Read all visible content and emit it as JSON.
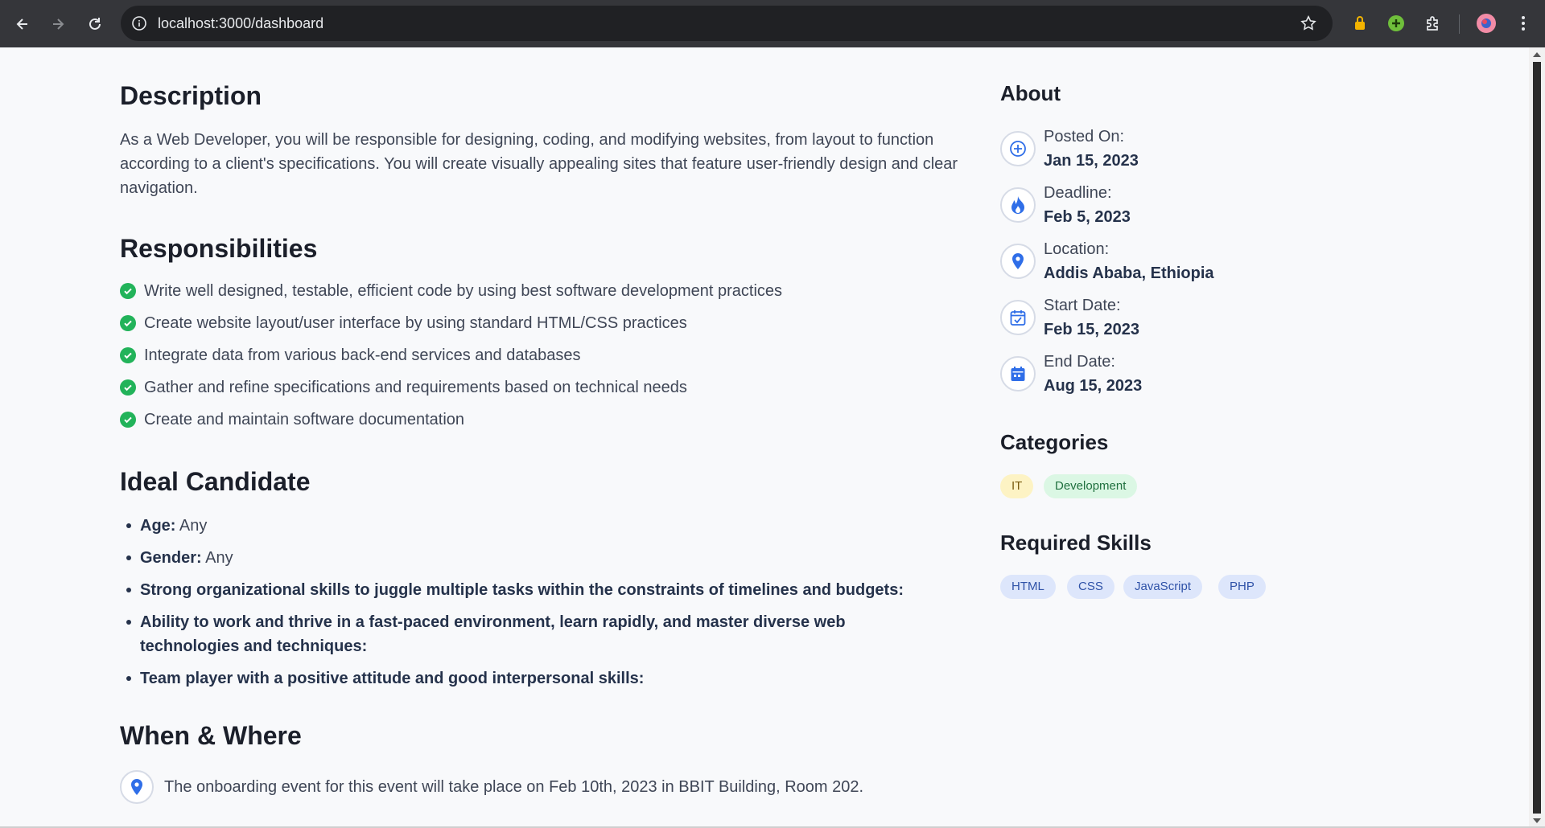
{
  "browser": {
    "url": "localhost:3000/dashboard"
  },
  "description": {
    "heading": "Description",
    "text": "As a Web Developer, you will be responsible for designing, coding, and modifying websites, from layout to function according to a client's specifications. You will create visually appealing sites that feature user-friendly design and clear navigation."
  },
  "responsibilities": {
    "heading": "Responsibilities",
    "items": [
      "Write well designed, testable, efficient code by using best software development practices",
      "Create website layout/user interface by using standard HTML/CSS practices",
      "Integrate data from various back-end services and databases",
      "Gather and refine specifications and requirements based on technical needs",
      "Create and maintain software documentation"
    ]
  },
  "ideal_candidate": {
    "heading": "Ideal Candidate",
    "age_label": "Age:",
    "age_value": "Any",
    "gender_label": "Gender:",
    "gender_value": "Any",
    "traits": [
      "Strong organizational skills to juggle multiple tasks within the constraints of timelines and budgets:",
      "Ability to work and thrive in a fast-paced environment, learn rapidly, and master diverse web technologies and techniques:",
      "Team player with a positive attitude and good interpersonal skills:"
    ]
  },
  "when_where": {
    "heading": "When & Where",
    "text": "The onboarding event for this event will take place on Feb 10th, 2023 in BBIT Building, Room 202."
  },
  "about": {
    "heading": "About",
    "items": [
      {
        "label": "Posted On:",
        "value": "Jan 15, 2023",
        "icon": "plus-circle-icon"
      },
      {
        "label": "Deadline:",
        "value": "Feb 5, 2023",
        "icon": "fire-icon"
      },
      {
        "label": "Location:",
        "value": "Addis Ababa, Ethiopia",
        "icon": "location-pin-icon"
      },
      {
        "label": "Start Date:",
        "value": "Feb 15, 2023",
        "icon": "calendar-check-icon"
      },
      {
        "label": "End Date:",
        "value": "Aug 15, 2023",
        "icon": "calendar-filled-icon"
      }
    ]
  },
  "categories": {
    "heading": "Categories",
    "items": [
      "IT",
      "Development"
    ]
  },
  "skills": {
    "heading": "Required Skills",
    "items": [
      "HTML",
      "CSS",
      "JavaScript",
      "PHP"
    ]
  },
  "colors": {
    "accent_blue": "#2f6ee8",
    "check_green": "#22b35a"
  }
}
